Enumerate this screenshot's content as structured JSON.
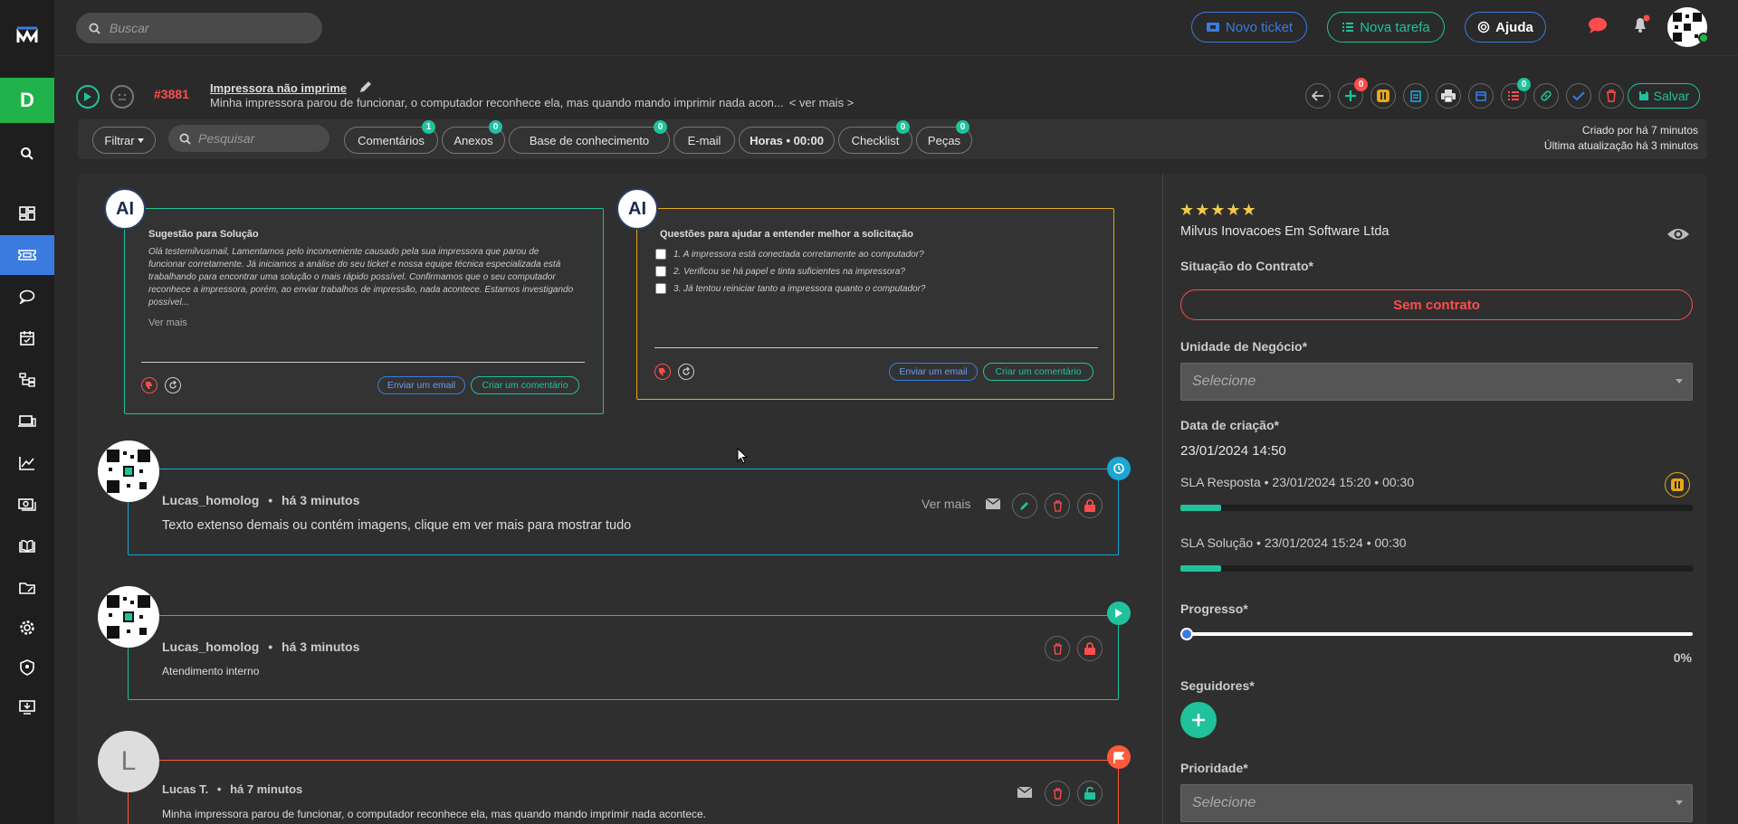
{
  "topbar": {
    "search_placeholder": "Buscar",
    "new_ticket_label": "Novo ticket",
    "new_task_label": "Nova tarefa",
    "help_label": "Ajuda"
  },
  "sidebar": {
    "workspace_letter": "D"
  },
  "ticket": {
    "number": "#3881",
    "title": "Impressora não imprime",
    "description": "Minha impressora parou de funcionar, o computador reconhece ela, mas quando mando imprimir nada acon...",
    "see_more": "< ver mais >",
    "save_label": "Salvar",
    "badges": {
      "add": "0",
      "checklist": "0"
    }
  },
  "filters": {
    "filter_label": "Filtrar",
    "search_placeholder": "Pesquisar",
    "tabs": [
      {
        "label": "Comentários",
        "count": "1"
      },
      {
        "label": "Anexos",
        "count": "0"
      },
      {
        "label": "Base de conhecimento",
        "count": "0"
      },
      {
        "label": "E-mail"
      },
      {
        "label": "Horas • 00:00"
      },
      {
        "label": "Checklist",
        "count": "0"
      },
      {
        "label": "Peças",
        "count": "0"
      }
    ],
    "created": "Criado por há 7 minutos",
    "updated": "Última atualização há 3 minutos"
  },
  "ai_suggestion": {
    "logo": "AI",
    "title": "Sugestão para Solução",
    "text": "Olá testemilvusmail, Lamentamos pelo inconveniente causado pela sua impressora que parou de funcionar corretamente. Já iniciamos a análise do seu ticket e nossa equipe técnica especializada está trabalhando para encontrar uma solução o mais rápido possível. Confirmamos que o seu computador reconhece a impressora, porém, ao enviar trabalhos de impressão, nada acontece. Estamos investigando possível...",
    "see_more": "Ver mais",
    "send_email": "Enviar um email",
    "create_comment": "Criar um comentário"
  },
  "ai_questions": {
    "logo": "AI",
    "title": "Questões para ajudar a entender melhor a solicitação",
    "questions": [
      "1. A impressora está conectada corretamente ao computador?",
      "2. Verificou se há papel e tinta suficientes na impressora?",
      "3. Já tentou reiniciar tanto a impressora quanto o computador?"
    ],
    "send_email": "Enviar um email",
    "create_comment": "Criar um comentário"
  },
  "comments": [
    {
      "author": "Lucas_homolog",
      "time": "há 3 minutos",
      "text": "Texto extenso demais ou contém imagens, clique em ver mais para mostrar tudo",
      "see_more": "Ver mais",
      "color": "#1ba6d4"
    },
    {
      "author": "Lucas_homolog",
      "time": "há 3 minutos",
      "text": "Atendimento interno",
      "color": "#1fc29b"
    },
    {
      "author": "Lucas T.",
      "time": "há 7 minutos",
      "initial": "L",
      "text": "Minha impressora parou de funcionar, o computador reconhece ela, mas quando mando imprimir nada acontece.",
      "color": "#ff5a3c"
    }
  ],
  "right_panel": {
    "rating": "★★★★★",
    "company": "Milvus Inovacoes Em Software Ltda",
    "contract_label": "Situação do Contrato*",
    "contract_value": "Sem contrato",
    "business_unit_label": "Unidade de Negócio*",
    "business_unit_placeholder": "Selecione",
    "created_label": "Data de criação*",
    "created_value": "23/01/2024 14:50",
    "sla_response": "SLA Resposta • 23/01/2024 15:20 • 00:30",
    "sla_response_progress": 0.08,
    "sla_solution": "SLA Solução • 23/01/2024 15:24 • 00:30",
    "sla_solution_progress": 0.08,
    "progress_label": "Progresso*",
    "progress_value": "0%",
    "followers_label": "Seguidores*",
    "priority_label": "Prioridade*",
    "priority_placeholder": "Selecione"
  }
}
